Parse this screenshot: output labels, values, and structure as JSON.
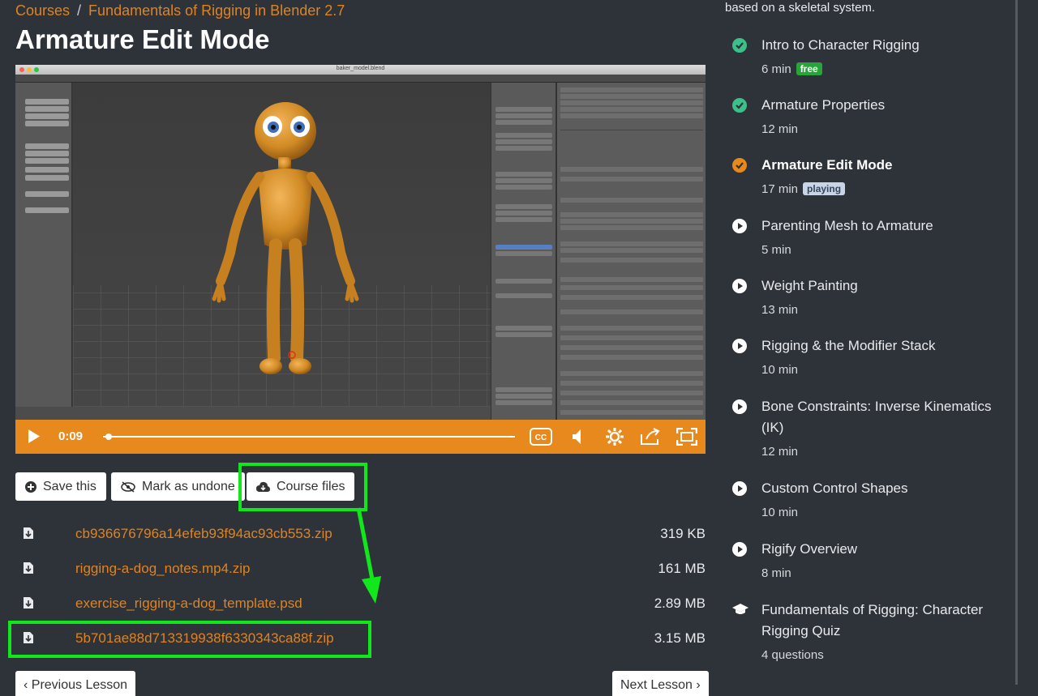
{
  "breadcrumb": {
    "courses": "Courses",
    "separator": "/",
    "course": "Fundamentals of Rigging in Blender 2.7"
  },
  "lesson_title": "Armature Edit Mode",
  "video": {
    "window_title": "baker_model.blend",
    "current_time": "0:09",
    "progress_fraction": 0.01
  },
  "actions": {
    "save": "Save this",
    "mark": "Mark as undone",
    "files": "Course files"
  },
  "files": [
    {
      "name": "cb936676796a14efeb93f94ac93cb553.zip",
      "size": "319 KB"
    },
    {
      "name": "rigging-a-dog_notes.mp4.zip",
      "size": "161 MB"
    },
    {
      "name": "exercise_rigging-a-dog_template.psd",
      "size": "2.89 MB"
    },
    {
      "name": "5b701ae88d713319938f6330343ca88f.zip",
      "size": "3.15 MB"
    }
  ],
  "nav": {
    "prev": "Previous Lesson",
    "next": "Next Lesson"
  },
  "sidebar": {
    "description_tail": "based on a skeletal system.",
    "lessons": [
      {
        "title": "Intro to Character Rigging",
        "meta": "6 min",
        "badge": "free",
        "status": "done"
      },
      {
        "title": "Armature Properties",
        "meta": "12 min",
        "badge": "",
        "status": "done"
      },
      {
        "title": "Armature Edit Mode",
        "meta": "17 min",
        "badge": "playing",
        "status": "current"
      },
      {
        "title": "Parenting Mesh to Armature",
        "meta": "5 min",
        "badge": "",
        "status": "todo"
      },
      {
        "title": "Weight Painting",
        "meta": "13 min",
        "badge": "",
        "status": "todo"
      },
      {
        "title": "Rigging & the Modifier Stack",
        "meta": "10 min",
        "badge": "",
        "status": "todo"
      },
      {
        "title": "Bone Constraints: Inverse Kinematics (IK)",
        "meta": "12 min",
        "badge": "",
        "status": "todo"
      },
      {
        "title": "Custom Control Shapes",
        "meta": "10 min",
        "badge": "",
        "status": "todo"
      },
      {
        "title": "Rigify Overview",
        "meta": "8 min",
        "badge": "",
        "status": "todo"
      },
      {
        "title": "Fundamentals of Rigging: Character Rigging Quiz",
        "meta": "4 questions",
        "badge": "",
        "status": "quiz"
      }
    ]
  },
  "colors": {
    "accent": "#e0831f",
    "highlight": "#11e81c",
    "done": "#3dbf8a",
    "current": "#e8891c",
    "free_badge": "#27a53a",
    "playing_badge": "#c9d4e6"
  }
}
